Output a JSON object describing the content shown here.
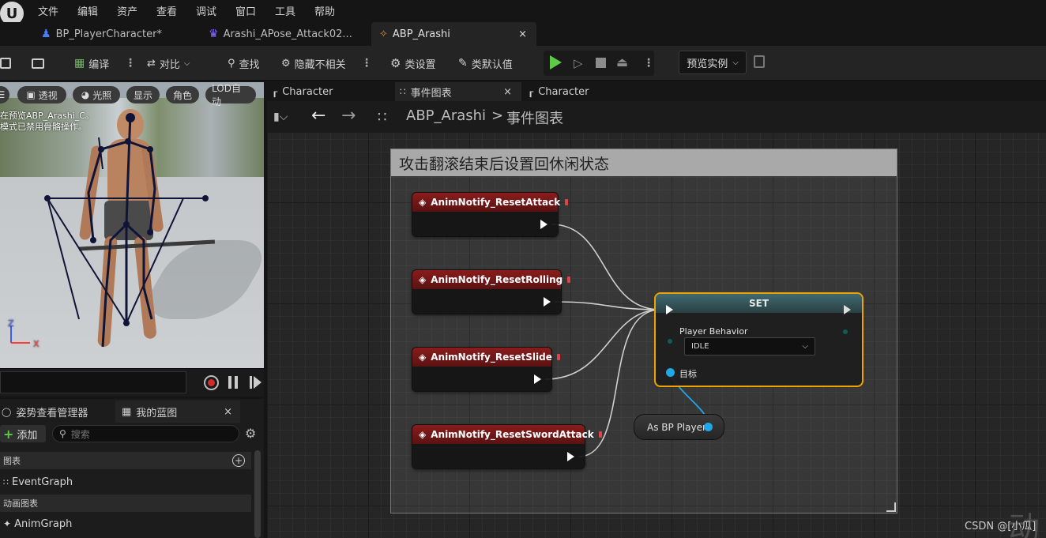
{
  "menu": [
    "文件",
    "编辑",
    "资产",
    "查看",
    "调试",
    "窗口",
    "工具",
    "帮助"
  ],
  "doc_tabs": [
    {
      "label": "BP_PlayerCharacter*",
      "icon": "person-icon"
    },
    {
      "label": "Arashi_APose_Attack02...",
      "icon": "animation-icon"
    },
    {
      "label": "ABP_Arashi",
      "icon": "anim-blueprint-icon",
      "close": "×"
    }
  ],
  "toolbar": {
    "compile": "编译",
    "diff": "对比",
    "find": "查找",
    "hide_unrelated": "隐藏不相关",
    "class_settings": "类设置",
    "class_defaults": "类默认值",
    "preview_instance": "预览实例"
  },
  "viewport": {
    "menu_icon": "☰",
    "buttons": [
      "透视",
      "光照",
      "显示",
      "角色",
      "LOD自动"
    ],
    "overlay_line1": "在预览ABP_Arashi_C。",
    "overlay_line2": "模式已禁用骨骼操作。",
    "axis_z": "Z",
    "axis_x": "X"
  },
  "left_panel": {
    "tab1": "姿势查看管理器",
    "tab2": "我的蓝图",
    "tab2_close": "×",
    "add": "添加",
    "search_placeholder": "搜索",
    "section_graphs": "图表",
    "item_eventgraph": "EventGraph",
    "section_anim": "动画图表",
    "item_animgraph": "AnimGraph"
  },
  "graph_tabs": [
    {
      "label": "Character"
    },
    {
      "label": "事件图表",
      "close": "×"
    },
    {
      "label": "Character"
    }
  ],
  "breadcrumb": {
    "root": "ABP_Arashi",
    "sep": ">",
    "leaf": "事件图表"
  },
  "comment_title": "攻击翻滚结束后设置回休闲状态",
  "events": [
    "AnimNotify_ResetAttack",
    "AnimNotify_ResetRolling",
    "AnimNotify_ResetSlide",
    "AnimNotify_ResetSwordAttack"
  ],
  "set_node": {
    "title": "SET",
    "var_label": "Player Behavior",
    "value": "IDLE",
    "target_label": "目标"
  },
  "cast_node": {
    "label": "As BP Player"
  },
  "watermark": "CSDN @[小瓜]",
  "partial_glyph": "动",
  "colors": {
    "accent_play": "#5fc94a",
    "selection": "#f0a300",
    "event_head": "#8a1c1c",
    "object_pin": "#1fa7e6"
  }
}
